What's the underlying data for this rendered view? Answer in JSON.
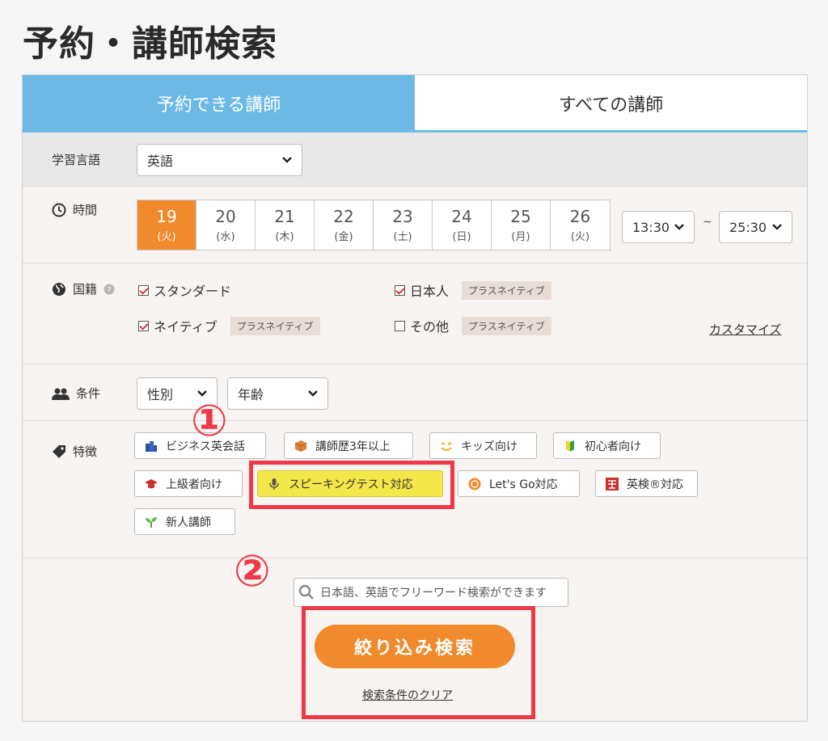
{
  "page": {
    "title": "予約・講師検索"
  },
  "tabs": [
    {
      "label": "予約できる講師",
      "active": true
    },
    {
      "label": "すべての講師",
      "active": false
    }
  ],
  "language": {
    "label": "学習言語",
    "selected": "英語"
  },
  "time": {
    "label": "時間",
    "days": [
      {
        "num": "19",
        "dow": "(火)",
        "active": true
      },
      {
        "num": "20",
        "dow": "(水)",
        "active": false
      },
      {
        "num": "21",
        "dow": "(木)",
        "active": false
      },
      {
        "num": "22",
        "dow": "(金)",
        "active": false
      },
      {
        "num": "23",
        "dow": "(土)",
        "active": false
      },
      {
        "num": "24",
        "dow": "(日)",
        "active": false
      },
      {
        "num": "25",
        "dow": "(月)",
        "active": false
      },
      {
        "num": "26",
        "dow": "(火)",
        "active": false
      }
    ],
    "from": "13:30",
    "tilde": "~",
    "to": "25:30"
  },
  "nationality": {
    "label": "国籍",
    "options": [
      {
        "label": "スタンダード",
        "checked": true,
        "tag": ""
      },
      {
        "label": "日本人",
        "checked": true,
        "tag": "プラスネイティブ"
      },
      {
        "label": "ネイティブ",
        "checked": true,
        "tag": "プラスネイティブ"
      },
      {
        "label": "その他",
        "checked": false,
        "tag": "プラスネイティブ"
      }
    ],
    "customize": "カスタマイズ"
  },
  "conditions": {
    "label": "条件",
    "gender": "性別",
    "age": "年齢"
  },
  "features": {
    "label": "特徴",
    "chips": [
      {
        "label": "ビジネス英会話",
        "icon": "buildings-icon"
      },
      {
        "label": "講師歴3年以上",
        "icon": "box-icon"
      },
      {
        "label": "キッズ向け",
        "icon": "smile-icon"
      },
      {
        "label": "初心者向け",
        "icon": "beginner-mark-icon"
      },
      {
        "label": "上級者向け",
        "icon": "graduation-cap-icon"
      },
      {
        "label": "スピーキングテスト対応",
        "icon": "microphone-icon",
        "highlighted": true
      },
      {
        "label": "Let's Go対応",
        "icon": "letsgo-badge-icon"
      },
      {
        "label": "英検®対応",
        "icon": "eiken-badge-icon"
      },
      {
        "label": "新人講師",
        "icon": "sprout-icon"
      }
    ]
  },
  "search": {
    "placeholder": "日本語、英語でフリーワード検索ができます"
  },
  "actions": {
    "submit": "絞り込み検索",
    "clear": "検索条件のクリア"
  },
  "annotations": {
    "marker1": "①",
    "marker2": "②",
    "color": "#ee3a48"
  },
  "colors": {
    "accent_blue": "#6cb9e6",
    "accent_orange": "#f08a2c",
    "highlight_yellow": "#f4e74a"
  }
}
